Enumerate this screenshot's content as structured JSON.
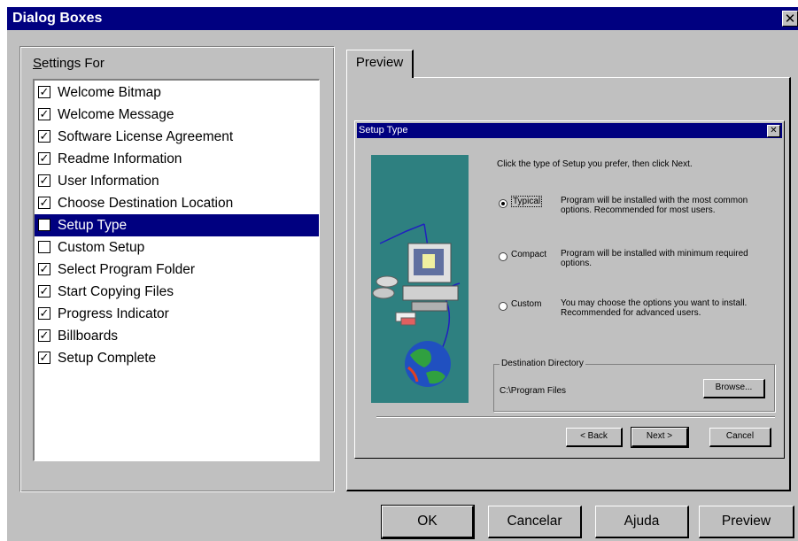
{
  "window": {
    "title": "Dialog Boxes",
    "close_glyph": "✕"
  },
  "settings": {
    "label": "Settings For",
    "items": [
      {
        "label": "Welcome Bitmap",
        "checked": true
      },
      {
        "label": "Welcome Message",
        "checked": true
      },
      {
        "label": "Software License Agreement",
        "checked": true
      },
      {
        "label": "Readme Information",
        "checked": true
      },
      {
        "label": "User Information",
        "checked": true
      },
      {
        "label": "Choose Destination Location",
        "checked": true
      },
      {
        "label": "Setup Type",
        "checked": false,
        "selected": true
      },
      {
        "label": "Custom Setup",
        "checked": false
      },
      {
        "label": "Select Program Folder",
        "checked": true
      },
      {
        "label": "Start Copying Files",
        "checked": true
      },
      {
        "label": "Progress Indicator",
        "checked": true
      },
      {
        "label": "Billboards",
        "checked": true
      },
      {
        "label": "Setup Complete",
        "checked": true
      }
    ]
  },
  "tabs": {
    "preview": "Preview"
  },
  "inner_dialog": {
    "title": "Setup Type",
    "close_glyph": "✕",
    "instruction": "Click the type of Setup you prefer, then click Next.",
    "options": [
      {
        "label": "Typical",
        "desc": "Program will be installed with the most common options. Recommended for most users.",
        "selected": true
      },
      {
        "label": "Compact",
        "desc": "Program will be installed with minimum required options.",
        "selected": false
      },
      {
        "label": "Custom",
        "desc": "You may choose the options you want to install. Recommended for advanced users.",
        "selected": false
      }
    ],
    "destination": {
      "legend": "Destination Directory",
      "path": "C:\\Program Files",
      "browse": "Browse..."
    },
    "buttons": {
      "back": "< Back",
      "next": "Next >",
      "cancel": "Cancel"
    }
  },
  "buttons": {
    "ok": "OK",
    "cancel": "Cancelar",
    "help": "Ajuda",
    "preview": "Preview"
  },
  "colors": {
    "titlebar": "#000080",
    "face": "#c0c0c0",
    "art_bg": "#2e8080"
  }
}
